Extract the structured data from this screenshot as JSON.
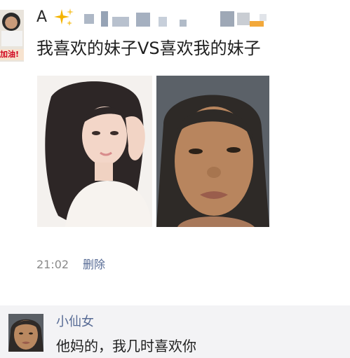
{
  "post": {
    "author_initial": "A",
    "author_avatar_badge": "加油!",
    "text": "我喜欢的妹子VS喜欢我的妹子",
    "timestamp": "21:02",
    "delete_label": "删除",
    "images": [
      {
        "icon": "woman-portrait-photo"
      },
      {
        "icon": "woman-selfie-photo"
      }
    ]
  },
  "comments": [
    {
      "author": "小仙女",
      "text": "他妈的，我几时喜欢你"
    }
  ],
  "colors": {
    "link": "#576b95",
    "comment_bg": "#f3f3f5",
    "badge_text": "#d0021b"
  }
}
